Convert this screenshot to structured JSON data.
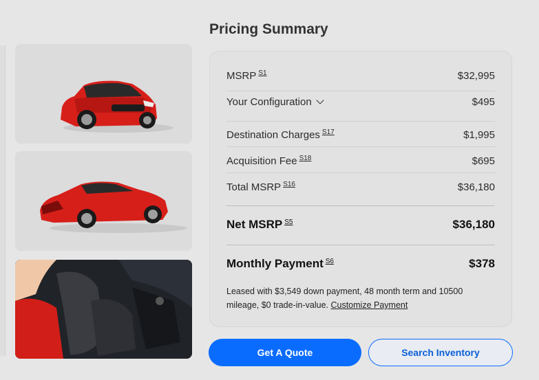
{
  "heading": "Pricing Summary",
  "rows": {
    "msrp": {
      "label": "MSRP",
      "ref": "S1",
      "value": "$32,995"
    },
    "config": {
      "label": "Your Configuration",
      "value": "$495"
    },
    "destination": {
      "label": "Destination Charges",
      "ref": "S17",
      "value": "$1,995"
    },
    "acquisition": {
      "label": "Acquisition Fee",
      "ref": "S18",
      "value": "$695"
    },
    "total": {
      "label": "Total MSRP",
      "ref": "S16",
      "value": "$36,180"
    },
    "net": {
      "label": "Net MSRP",
      "ref": "S5",
      "value": "$36,180"
    },
    "monthly": {
      "label": "Monthly Payment",
      "ref": "S6",
      "value": "$378"
    }
  },
  "note": {
    "text": "Leased with $3,549 down payment, 48 month term and 10500 mileage, $0 trade-in-value.",
    "link": "Customize Payment"
  },
  "buttons": {
    "quote": "Get A Quote",
    "inventory": "Search Inventory"
  },
  "colors": {
    "accent": "#0a6cff",
    "car_red": "#d71f1a",
    "background": "#e6e6e6"
  }
}
